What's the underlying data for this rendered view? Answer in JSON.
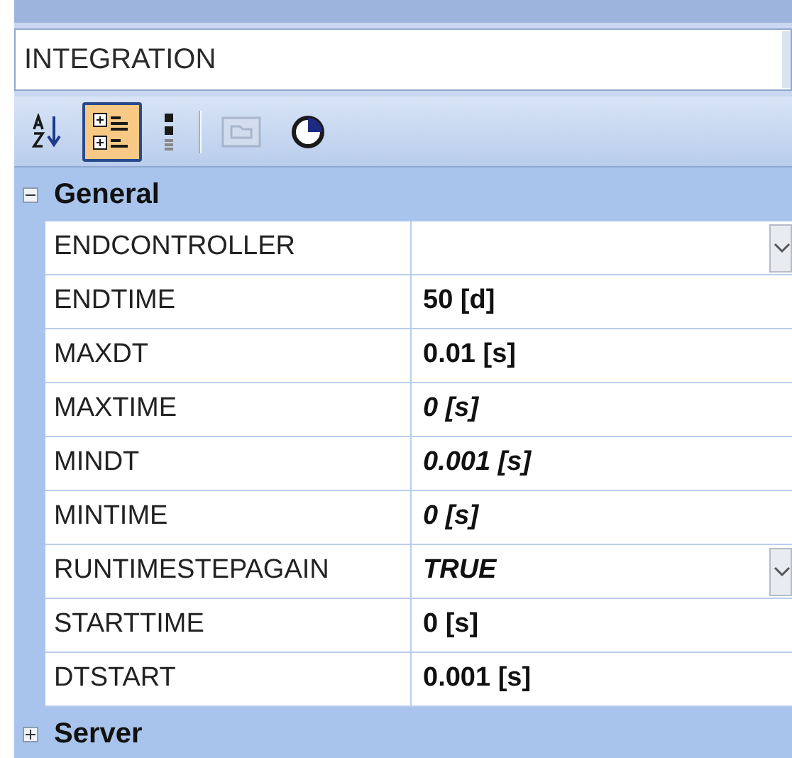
{
  "object_selector": {
    "value": "INTEGRATION"
  },
  "toolbar": [
    {
      "kind": "sort",
      "selected": false,
      "disabled": false
    },
    {
      "kind": "categorized",
      "selected": true,
      "disabled": false
    },
    {
      "kind": "list",
      "selected": false,
      "disabled": false
    },
    {
      "kind": "pages",
      "selected": false,
      "disabled": true
    },
    {
      "kind": "clock",
      "selected": false,
      "disabled": false
    }
  ],
  "categories": [
    {
      "label": "General",
      "expanded": true,
      "properties": [
        {
          "name": "ENDCONTROLLER",
          "italic": false,
          "dropdown": true
        },
        {
          "name": "ENDTIME",
          "value": "50 [d]",
          "italic": false,
          "dropdown": false
        },
        {
          "name": "MAXDT",
          "value": "0.01 [s]",
          "italic": false,
          "dropdown": false
        },
        {
          "name": "MAXTIME",
          "value": "0 [s]",
          "italic": true,
          "dropdown": false
        },
        {
          "name": "MINDT",
          "value": "0.001 [s]",
          "italic": true,
          "dropdown": false
        },
        {
          "name": "MINTIME",
          "value": "0 [s]",
          "italic": true,
          "dropdown": false
        },
        {
          "name": "RUNTIMESTEPAGAIN",
          "value": "TRUE",
          "italic": true,
          "dropdown": true
        },
        {
          "name": "STARTTIME",
          "value": "0 [s]",
          "italic": false,
          "dropdown": false
        },
        {
          "name": "DTSTART",
          "value": "0.001 [s]",
          "italic": false,
          "dropdown": false
        }
      ]
    },
    {
      "label": "Server",
      "expanded": false
    }
  ]
}
